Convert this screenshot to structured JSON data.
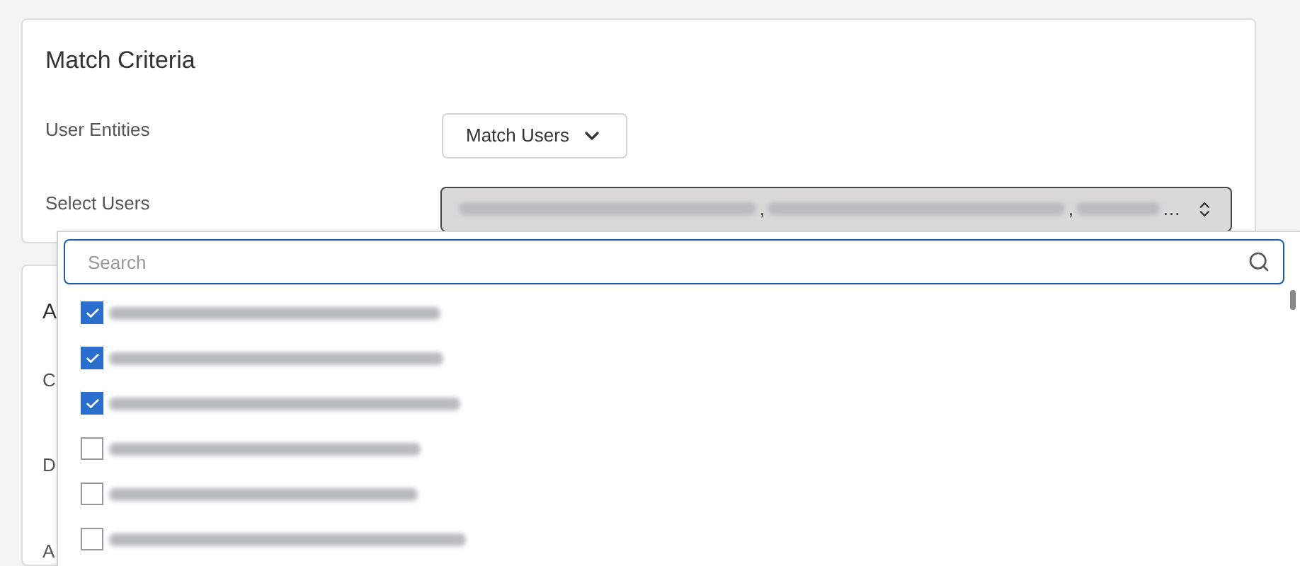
{
  "match_criteria": {
    "title": "Match Criteria",
    "user_entities": {
      "label": "User Entities",
      "value": "Match Users"
    },
    "select_users": {
      "label": "Select Users",
      "value_parts": [
        {
          "kind": "redacted"
        },
        {
          "kind": "text",
          "text": ","
        },
        {
          "kind": "redacted"
        },
        {
          "kind": "text",
          "text": ","
        },
        {
          "kind": "redacted"
        },
        {
          "kind": "text",
          "text": "…"
        }
      ]
    }
  },
  "second_card": {
    "title": "A",
    "labels": [
      "C",
      "D",
      "A"
    ]
  },
  "user_dropdown": {
    "search": {
      "placeholder": "Search"
    },
    "items": [
      {
        "checked": true
      },
      {
        "checked": true
      },
      {
        "checked": true
      },
      {
        "checked": false
      },
      {
        "checked": false
      },
      {
        "checked": false
      }
    ]
  }
}
